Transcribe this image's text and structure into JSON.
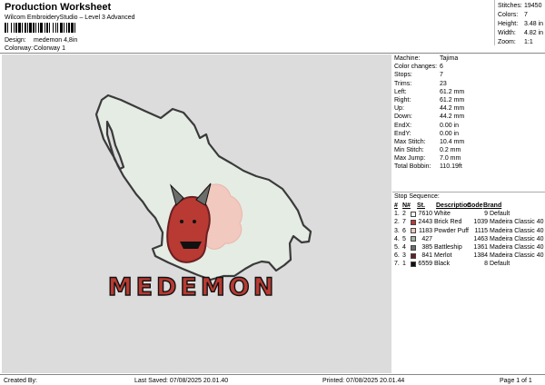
{
  "header": {
    "title": "Production Worksheet",
    "software": "Wilcom EmbroideryStudio – Level 3 Advanced",
    "design_label": "Design:",
    "design_value": "medemon 4,8in",
    "colorway_label": "Colorway:",
    "colorway_value": "Colorway 1"
  },
  "stats": [
    {
      "label": "Stitches:",
      "value": "19450"
    },
    {
      "label": "Colors:",
      "value": "7"
    },
    {
      "label": "Height:",
      "value": "3.48 in"
    },
    {
      "label": "Width:",
      "value": "4.82 in"
    },
    {
      "label": "Zoom:",
      "value": "1:1"
    }
  ],
  "design": {
    "text": "MEDEMON",
    "colors": {
      "map_fill": "#e4ece4",
      "map_outline": "#3a3a3a",
      "brick_red": "#b83a32",
      "powder_puff": "#f1c9be",
      "battleship": "#6b6e6b",
      "merlot": "#6a1f22",
      "black": "#111111",
      "light_green": "#a3b5a3"
    }
  },
  "info": [
    {
      "label": "Machine:",
      "value": "Tajima"
    },
    {
      "label": "Color changes:",
      "value": "6"
    },
    {
      "label": "Stops:",
      "value": "7"
    },
    {
      "label": "Trims:",
      "value": "23"
    },
    {
      "label": "Left:",
      "value": "61.2 mm"
    },
    {
      "label": "Right:",
      "value": "61.2 mm"
    },
    {
      "label": "Up:",
      "value": "44.2 mm"
    },
    {
      "label": "Down:",
      "value": "44.2 mm"
    },
    {
      "label": "EndX:",
      "value": "0.00 in"
    },
    {
      "label": "EndY:",
      "value": "0.00 in"
    },
    {
      "label": "Max Stitch:",
      "value": "10.4 mm"
    },
    {
      "label": "Min Stitch:",
      "value": "0.2 mm"
    },
    {
      "label": "Max Jump:",
      "value": "7.0 mm"
    },
    {
      "label": "Total Bobbin:",
      "value": "110.19ft"
    }
  ],
  "stop_sequence": {
    "heading": "Stop Sequence:",
    "headers": {
      "num": "#",
      "n": "N#",
      "st": "St.",
      "code": "Code",
      "brand": "Brand",
      "desc": "Description"
    },
    "rows": [
      {
        "num": "1.",
        "n": "2",
        "swatch": "#f4f4f0",
        "st": "7610",
        "desc": "White",
        "code": "9",
        "brand": "Default"
      },
      {
        "num": "2.",
        "n": "7",
        "swatch": "#b83a32",
        "st": "2443",
        "desc": "Brick Red",
        "code": "1039",
        "brand": "Madeira Classic 40"
      },
      {
        "num": "3.",
        "n": "6",
        "swatch": "#f1c9be",
        "st": "1183",
        "desc": "Powder Puff",
        "code": "1115",
        "brand": "Madeira Classic 40"
      },
      {
        "num": "4.",
        "n": "5",
        "swatch": "#a3b5a3",
        "st": "427",
        "desc": "",
        "code": "1463",
        "brand": "Madeira Classic 40"
      },
      {
        "num": "5.",
        "n": "4",
        "swatch": "#6b6e6b",
        "st": "385",
        "desc": "Battleship",
        "code": "1361",
        "brand": "Madeira Classic 40"
      },
      {
        "num": "6.",
        "n": "3",
        "swatch": "#6a1f22",
        "st": "841",
        "desc": "Merlot",
        "code": "1384",
        "brand": "Madeira Classic 40"
      },
      {
        "num": "7.",
        "n": "1",
        "swatch": "#111111",
        "st": "6559",
        "desc": "Black",
        "code": "8",
        "brand": "Default"
      }
    ]
  },
  "footer": {
    "created_by": "Created By:",
    "last_saved": "Last Saved: 07/08/2025 20.01.40",
    "printed": "Printed: 07/08/2025 20.01.44",
    "page": "Page 1 of 1"
  }
}
